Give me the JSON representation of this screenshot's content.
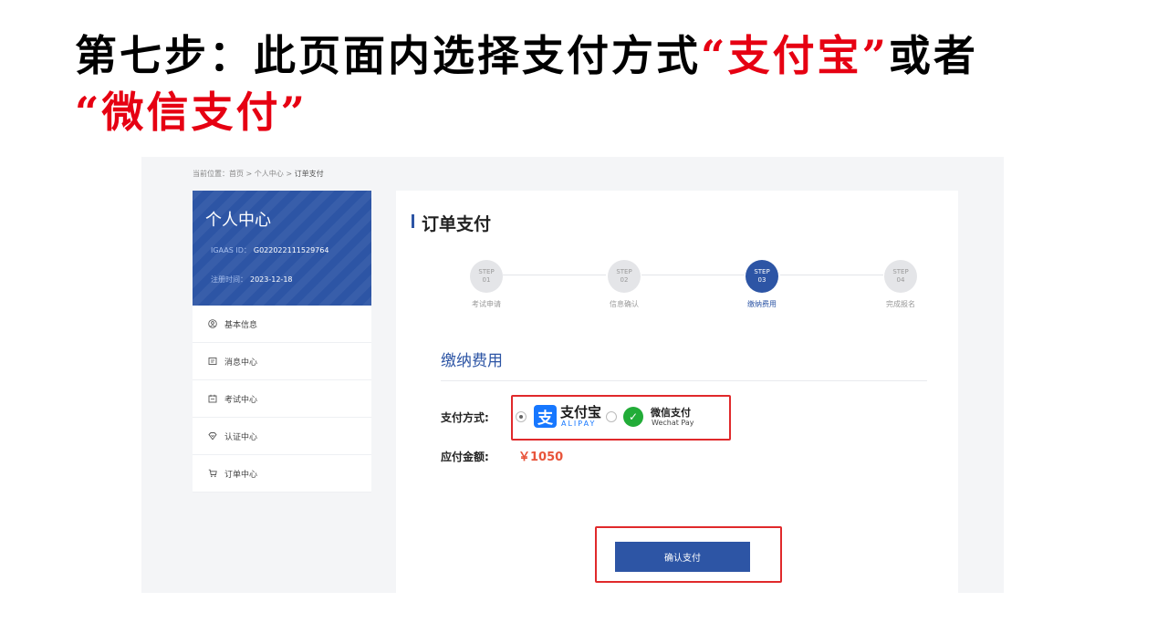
{
  "headline": {
    "part1": "第七步：此页面内选择支付方式",
    "quote1": "“支付宝”",
    "or": "或者",
    "quote2": "“微信支付”"
  },
  "breadcrumb": {
    "prefix": "当前位置：",
    "path": "首页 > 个人中心 > ",
    "current": "订单支付"
  },
  "sidebar": {
    "title": "个人中心",
    "id_key": "IGAAS ID：",
    "id_value": "G022022111529764",
    "reg_key": "注册时间：",
    "reg_value": "2023-12-18",
    "items": [
      {
        "label": "基本信息",
        "icon": "user-circle-icon"
      },
      {
        "label": "消息中心",
        "icon": "message-icon"
      },
      {
        "label": "考试中心",
        "icon": "calendar-icon"
      },
      {
        "label": "认证中心",
        "icon": "badge-icon"
      },
      {
        "label": "订单中心",
        "icon": "cart-icon"
      }
    ]
  },
  "main": {
    "title": "订单支付",
    "steps": [
      {
        "step": "STEP",
        "num": "01",
        "label": "考试申请",
        "active": false
      },
      {
        "step": "STEP",
        "num": "02",
        "label": "信息确认",
        "active": false
      },
      {
        "step": "STEP",
        "num": "03",
        "label": "缴纳费用",
        "active": true
      },
      {
        "step": "STEP",
        "num": "04",
        "label": "完成报名",
        "active": false
      }
    ],
    "section_title": "缴纳费用",
    "pay_label": "支付方式:",
    "alipay_name": "支付宝",
    "alipay_en": "ALIPAY",
    "wechat_name": "微信支付",
    "wechat_en": "Wechat Pay",
    "amount_label": "应付金额:",
    "amount": "￥1050",
    "confirm_label": "确认支付"
  },
  "colors": {
    "brand": "#2d55a5",
    "highlight": "#e0292b",
    "price": "#e8543a"
  }
}
